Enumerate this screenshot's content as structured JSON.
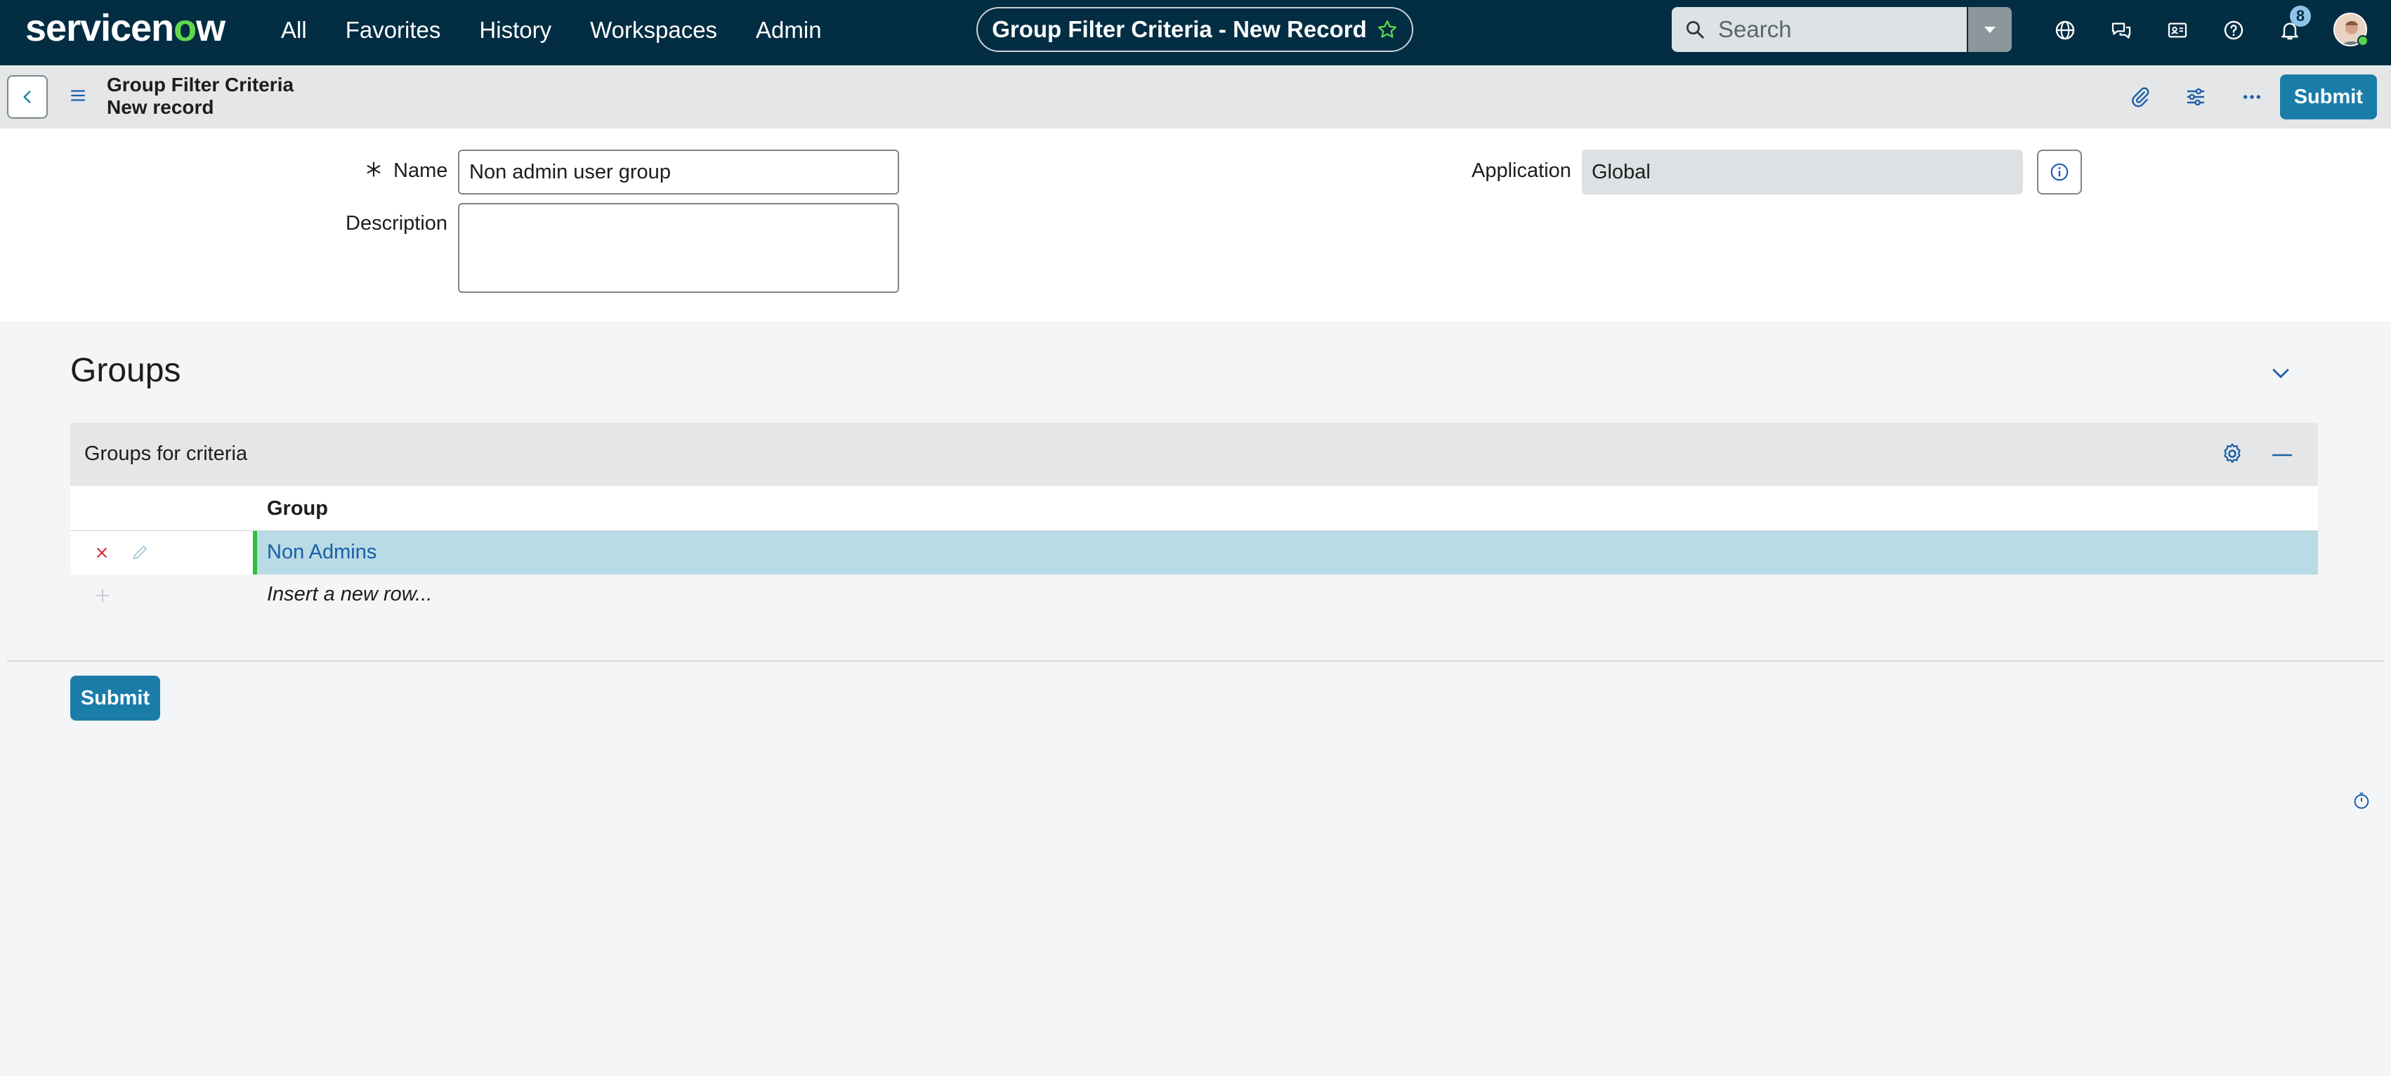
{
  "nav": {
    "logo_main": "servicen",
    "logo_o": "o",
    "logo_end": "w",
    "links": [
      "All",
      "Favorites",
      "History",
      "Workspaces",
      "Admin"
    ],
    "page_title": "Group Filter Criteria - New Record",
    "search_placeholder": "Search",
    "notification_count": "8"
  },
  "form_header": {
    "title": "Group Filter Criteria",
    "subtitle": "New record",
    "submit_label": "Submit"
  },
  "form": {
    "name_label": "Name",
    "name_value": "Non admin user group",
    "description_label": "Description",
    "description_value": "",
    "application_label": "Application",
    "application_value": "Global"
  },
  "groups": {
    "section_title": "Groups",
    "related_list_title": "Groups for criteria",
    "column_header": "Group",
    "rows": [
      {
        "group": "Non Admins"
      }
    ],
    "insert_row_text": "Insert a new row..."
  },
  "footer": {
    "submit_label": "Submit"
  },
  "colors": {
    "nav_bg": "#032d42",
    "accent": "#1a7da8",
    "logo_green": "#62d84e",
    "row_highlight": "#b8dbe5"
  }
}
